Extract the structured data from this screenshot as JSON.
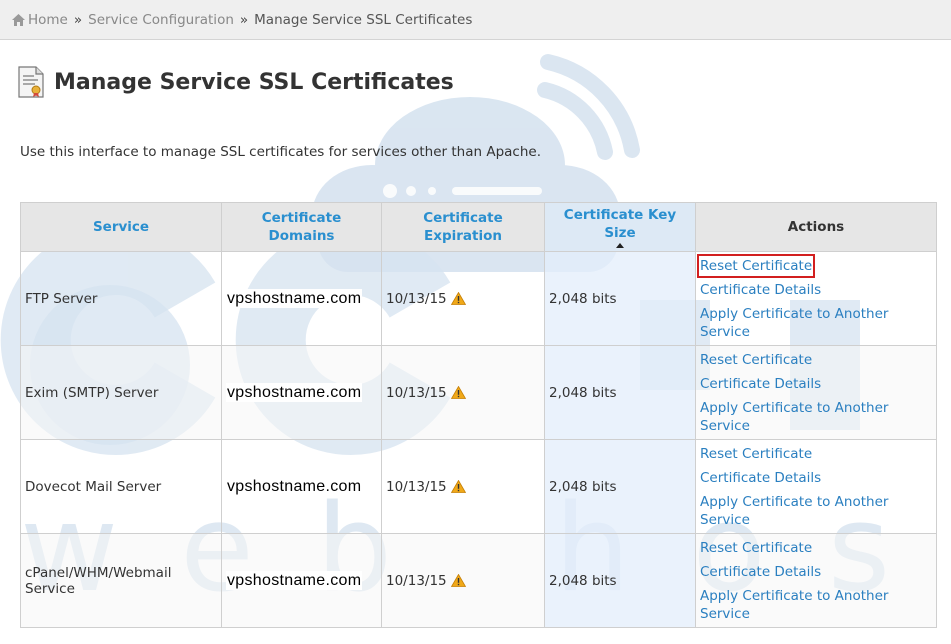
{
  "breadcrumb": {
    "home": "Home",
    "separator": "»",
    "service_configuration": "Service Configuration",
    "current": "Manage Service SSL Certificates"
  },
  "page": {
    "title": "Manage Service SSL Certificates",
    "intro": "Use this interface to manage SSL certificates for services other than Apache."
  },
  "table": {
    "headers": {
      "service": "Service",
      "domains": "Certificate Domains",
      "expiration_1": "Certificate",
      "expiration_2": "Expiration",
      "key_size_1": "Certificate Key",
      "key_size_2": "Size",
      "actions": "Actions"
    },
    "rows": [
      {
        "service": "FTP Server",
        "domain": "vpshostname.com",
        "expiration": "10/13/15",
        "key_size": "2,048 bits"
      },
      {
        "service": "Exim (SMTP) Server",
        "domain": "vpshostname.com",
        "expiration": "10/13/15",
        "key_size": "2,048 bits"
      },
      {
        "service": "Dovecot Mail Server",
        "domain": "vpshostname.com",
        "expiration": "10/13/15",
        "key_size": "2,048 bits"
      },
      {
        "service": "cPanel/WHM/Webmail Service",
        "domain": "vpshostname.com",
        "expiration": "10/13/15",
        "key_size": "2,048 bits"
      }
    ],
    "actions": {
      "reset": "Reset Certificate",
      "details": "Certificate Details",
      "apply": "Apply Certificate to Another Service"
    }
  },
  "watermark": {
    "line1": "accu",
    "line2": "web hosting"
  },
  "colors": {
    "link": "#2a7fc0",
    "header_link": "#2a8fcf",
    "highlight_box": "#d21f1f",
    "warning": "#f0a818"
  }
}
